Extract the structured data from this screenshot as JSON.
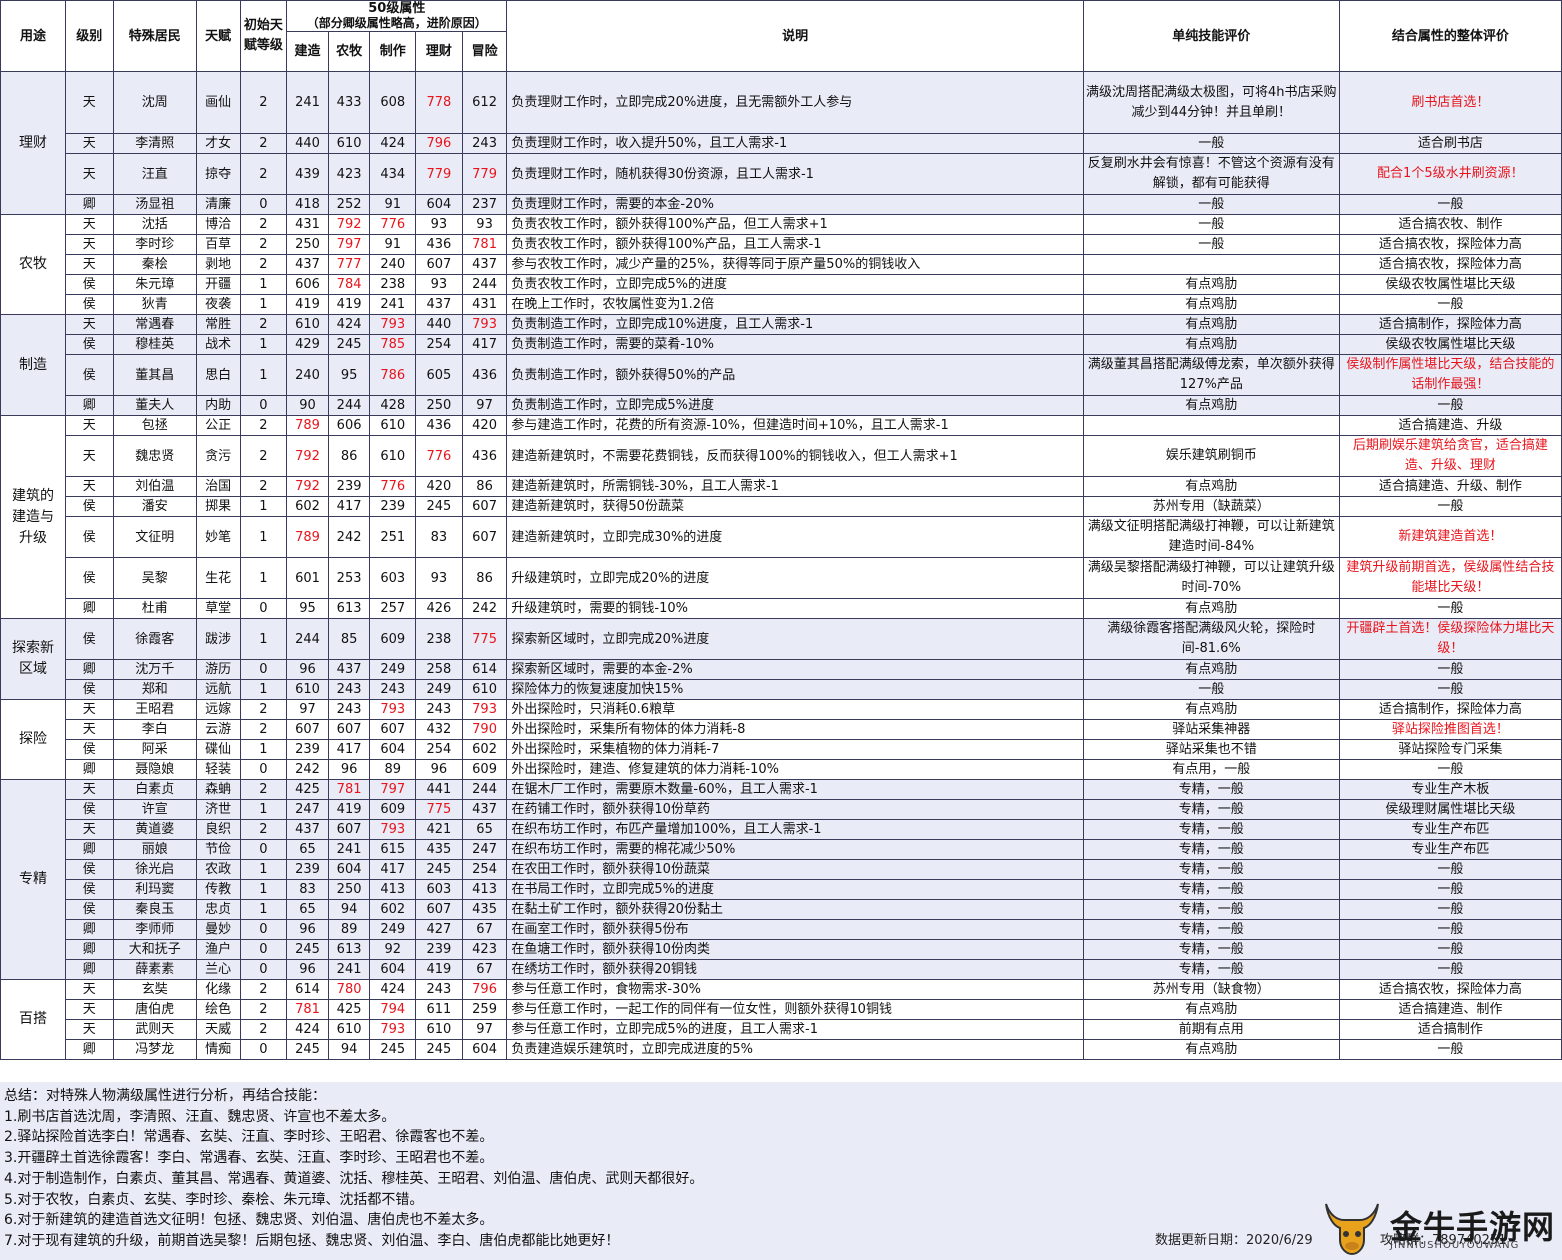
{
  "headers": {
    "use": "用途",
    "rank": "级别",
    "resident": "特殊居民",
    "talent": "天赋",
    "init_level": "初始天赋等级",
    "attr_group": "50级属性",
    "attr_note": "（部分卿级属性略高，进阶原因）",
    "build": "建造",
    "farm": "农牧",
    "craft": "制作",
    "finance": "理财",
    "explore": "冒险",
    "desc": "说明",
    "skill_eval": "单纯技能评价",
    "overall_eval": "结合属性的整体评价"
  },
  "groups": [
    {
      "label": "理财",
      "rows": [
        {
          "rank": "天",
          "name": "沈周",
          "talent": "画仙",
          "lvl": "2",
          "v": [
            "241",
            "433",
            "608",
            "778",
            "612"
          ],
          "red": [
            3
          ],
          "desc": "负责理财工作时，立即完成20%进度，且无需额外工人参与",
          "eval": "满级沈周搭配满级太极图，可将4h书店采购减少到44分钟！并且单刷！",
          "eval_red": false,
          "overall": "刷书店首选！",
          "overall_red": true,
          "tall": 3
        },
        {
          "rank": "天",
          "name": "李清照",
          "talent": "才女",
          "lvl": "2",
          "v": [
            "440",
            "610",
            "424",
            "796",
            "243"
          ],
          "red": [
            3
          ],
          "desc": "负责理财工作时，收入提升50%，且工人需求-1",
          "eval": "一般",
          "overall": "适合刷书店"
        },
        {
          "rank": "天",
          "name": "汪直",
          "talent": "掠夺",
          "lvl": "2",
          "v": [
            "439",
            "423",
            "434",
            "779",
            "779"
          ],
          "red": [
            3,
            4
          ],
          "desc": "负责理财工作时，随机获得30份资源，且工人需求-1",
          "eval": "反复刷水井会有惊喜！不管这个资源有没有解锁，都有可能获得",
          "overall": "配合1个5级水井刷资源！",
          "overall_red": true,
          "tall": 2
        },
        {
          "rank": "卿",
          "name": "汤显祖",
          "talent": "清廉",
          "lvl": "0",
          "v": [
            "418",
            "252",
            "91",
            "604",
            "237"
          ],
          "red": [],
          "desc": "负责理财工作时，需要的本金-20%",
          "eval": "一般",
          "overall": "一般"
        }
      ]
    },
    {
      "label": "农牧",
      "rows": [
        {
          "rank": "天",
          "name": "沈括",
          "talent": "博洽",
          "lvl": "2",
          "v": [
            "431",
            "792",
            "776",
            "93",
            "93"
          ],
          "red": [
            1,
            2
          ],
          "desc": "负责农牧工作时，额外获得100%产品，但工人需求+1",
          "eval": "一般",
          "overall": "适合搞农牧、制作"
        },
        {
          "rank": "天",
          "name": "李时珍",
          "talent": "百草",
          "lvl": "2",
          "v": [
            "250",
            "797",
            "91",
            "436",
            "781"
          ],
          "red": [
            1,
            4
          ],
          "desc": "负责农牧工作时，额外获得100%产品，且工人需求-1",
          "eval": "一般",
          "overall": "适合搞农牧，探险体力高"
        },
        {
          "rank": "天",
          "name": "秦桧",
          "talent": "剥地",
          "lvl": "2",
          "v": [
            "437",
            "777",
            "240",
            "607",
            "437"
          ],
          "red": [
            1
          ],
          "desc": "参与农牧工作时，减少产量的25%，获得等同于原产量50%的铜钱收入",
          "eval": "",
          "overall": "适合搞农牧，探险体力高"
        },
        {
          "rank": "侯",
          "name": "朱元璋",
          "talent": "开疆",
          "lvl": "1",
          "v": [
            "606",
            "784",
            "238",
            "93",
            "244"
          ],
          "red": [
            1
          ],
          "desc": "负责农牧工作时，立即完成5%的进度",
          "eval": "有点鸡肋",
          "overall": "侯级农牧属性堪比天级"
        },
        {
          "rank": "侯",
          "name": "狄青",
          "talent": "夜袭",
          "lvl": "1",
          "v": [
            "419",
            "419",
            "241",
            "437",
            "431"
          ],
          "red": [],
          "desc": "在晚上工作时，农牧属性变为1.2倍",
          "eval": "有点鸡肋",
          "overall": "一般"
        }
      ]
    },
    {
      "label": "制造",
      "rows": [
        {
          "rank": "天",
          "name": "常遇春",
          "talent": "常胜",
          "lvl": "2",
          "v": [
            "610",
            "424",
            "793",
            "440",
            "793"
          ],
          "red": [
            2,
            4
          ],
          "desc": "负责制造工作时，立即完成10%进度，且工人需求-1",
          "eval": "有点鸡肋",
          "overall": "适合搞制作，探险体力高"
        },
        {
          "rank": "侯",
          "name": "穆桂英",
          "talent": "战术",
          "lvl": "1",
          "v": [
            "429",
            "245",
            "785",
            "254",
            "417"
          ],
          "red": [
            2
          ],
          "desc": "负责制造工作时，需要的菜肴-10%",
          "eval": "有点鸡肋",
          "overall": "侯级农牧属性堪比天级"
        },
        {
          "rank": "侯",
          "name": "董其昌",
          "talent": "思白",
          "lvl": "1",
          "v": [
            "240",
            "95",
            "786",
            "605",
            "436"
          ],
          "red": [
            2
          ],
          "desc": "负责制造工作时，额外获得50%的产品",
          "eval": "满级董其昌搭配满级傅龙索，单次额外获得127%产品",
          "overall": "侯级制作属性堪比天级，结合技能的话制作最强！",
          "overall_red": true,
          "tall": 2
        },
        {
          "rank": "卿",
          "name": "董夫人",
          "talent": "内助",
          "lvl": "0",
          "v": [
            "90",
            "244",
            "428",
            "250",
            "97"
          ],
          "red": [],
          "desc": "负责制造工作时，立即完成5%进度",
          "eval": "有点鸡肋",
          "overall": "一般"
        }
      ]
    },
    {
      "label": "建筑的建造与升级",
      "rows": [
        {
          "rank": "天",
          "name": "包拯",
          "talent": "公正",
          "lvl": "2",
          "v": [
            "789",
            "606",
            "610",
            "436",
            "420"
          ],
          "red": [
            0
          ],
          "desc": "参与建造工作时，花费的所有资源-10%，但建造时间+10%，且工人需求-1",
          "eval": "",
          "overall": "适合搞建造、升级"
        },
        {
          "rank": "天",
          "name": "魏忠贤",
          "talent": "贪污",
          "lvl": "2",
          "v": [
            "792",
            "86",
            "610",
            "776",
            "436"
          ],
          "red": [
            0,
            3
          ],
          "desc": "建造新建筑时，不需要花费铜钱，反而获得100%的铜钱收入，但工人需求+1",
          "eval": "娱乐建筑刷铜币",
          "overall": "后期刷娱乐建筑给贪官，适合搞建造、升级、理财",
          "overall_red": true,
          "tall": 2
        },
        {
          "rank": "天",
          "name": "刘伯温",
          "talent": "治国",
          "lvl": "2",
          "v": [
            "792",
            "239",
            "776",
            "420",
            "86"
          ],
          "red": [
            0,
            2
          ],
          "desc": "建造新建筑时，所需铜钱-30%，且工人需求-1",
          "eval": "有点鸡肋",
          "overall": "适合搞建造、升级、制作"
        },
        {
          "rank": "侯",
          "name": "潘安",
          "talent": "掷果",
          "lvl": "1",
          "v": [
            "602",
            "417",
            "239",
            "245",
            "607"
          ],
          "red": [],
          "desc": "建造新建筑时，获得50份蔬菜",
          "eval": "苏州专用（缺蔬菜）",
          "overall": "一般"
        },
        {
          "rank": "侯",
          "name": "文征明",
          "talent": "妙笔",
          "lvl": "1",
          "v": [
            "789",
            "242",
            "251",
            "83",
            "607"
          ],
          "red": [
            0
          ],
          "desc": "建造新建筑时，立即完成30%的进度",
          "eval": "满级文征明搭配满级打神鞭，可以让新建筑建造时间-84%",
          "overall": "新建筑建造首选！",
          "overall_red": true,
          "tall": 2
        },
        {
          "rank": "侯",
          "name": "吴黎",
          "talent": "生花",
          "lvl": "1",
          "v": [
            "601",
            "253",
            "603",
            "93",
            "86"
          ],
          "red": [],
          "desc": "升级建筑时，立即完成20%的进度",
          "eval": "满级吴黎搭配满级打神鞭，可以让建筑升级时间-70%",
          "overall": "建筑升级前期首选，侯级属性结合技能堪比天级！",
          "overall_red": true,
          "tall": 2
        },
        {
          "rank": "卿",
          "name": "杜甫",
          "talent": "草堂",
          "lvl": "0",
          "v": [
            "95",
            "613",
            "257",
            "426",
            "242"
          ],
          "red": [],
          "desc": "升级建筑时，需要的铜钱-10%",
          "eval": "有点鸡肋",
          "overall": "一般"
        }
      ]
    },
    {
      "label": "探索新区域",
      "rows": [
        {
          "rank": "侯",
          "name": "徐霞客",
          "talent": "跋涉",
          "lvl": "1",
          "v": [
            "244",
            "85",
            "609",
            "238",
            "775"
          ],
          "red": [
            4
          ],
          "desc": "探索新区域时，立即完成20%进度",
          "eval": "满级徐霞客搭配满级风火轮，探险时间-81.6%",
          "overall": "开疆辟土首选！侯级探险体力堪比天级！",
          "overall_red": true,
          "tall": 2
        },
        {
          "rank": "卿",
          "name": "沈万千",
          "talent": "游历",
          "lvl": "0",
          "v": [
            "96",
            "437",
            "249",
            "258",
            "614"
          ],
          "red": [],
          "desc": "探索新区域时，需要的本金-2%",
          "eval": "有点鸡肋",
          "overall": "一般"
        },
        {
          "rank": "侯",
          "name": "郑和",
          "talent": "远航",
          "lvl": "1",
          "v": [
            "610",
            "243",
            "243",
            "249",
            "610"
          ],
          "red": [],
          "desc": "探险体力的恢复速度加快15%",
          "eval": "一般",
          "overall": "一般"
        }
      ]
    },
    {
      "label": "探险",
      "rows": [
        {
          "rank": "天",
          "name": "王昭君",
          "talent": "远嫁",
          "lvl": "2",
          "v": [
            "97",
            "243",
            "793",
            "243",
            "793"
          ],
          "red": [
            2,
            4
          ],
          "desc": "外出探险时，只消耗0.6粮草",
          "eval": "有点鸡肋",
          "overall": "适合搞制作，探险体力高"
        },
        {
          "rank": "天",
          "name": "李白",
          "talent": "云游",
          "lvl": "2",
          "v": [
            "607",
            "607",
            "607",
            "432",
            "790"
          ],
          "red": [
            4
          ],
          "desc": "外出探险时，采集所有物体的体力消耗-8",
          "eval": "驿站采集神器",
          "overall": "驿站探险推图首选！",
          "overall_red": true
        },
        {
          "rank": "侯",
          "name": "阿采",
          "talent": "碟仙",
          "lvl": "1",
          "v": [
            "239",
            "417",
            "604",
            "254",
            "602"
          ],
          "red": [],
          "desc": "外出探险时，采集植物的体力消耗-7",
          "eval": "驿站采集也不错",
          "overall": "驿站探险专门采集"
        },
        {
          "rank": "卿",
          "name": "聂隐娘",
          "talent": "轻装",
          "lvl": "0",
          "v": [
            "242",
            "96",
            "89",
            "96",
            "609"
          ],
          "red": [],
          "desc": "外出探险时，建造、修复建筑的体力消耗-10%",
          "eval": "有点用，一般",
          "overall": "一般"
        }
      ]
    },
    {
      "label": "专精",
      "rows": [
        {
          "rank": "天",
          "name": "白素贞",
          "talent": "森蚺",
          "lvl": "2",
          "v": [
            "425",
            "781",
            "797",
            "441",
            "244"
          ],
          "red": [
            1,
            2
          ],
          "desc": "在锯木厂工作时，需要原木数量-60%，且工人需求-1",
          "eval": "专精，一般",
          "overall": "专业生产木板"
        },
        {
          "rank": "侯",
          "name": "许宣",
          "talent": "济世",
          "lvl": "1",
          "v": [
            "247",
            "419",
            "609",
            "775",
            "437"
          ],
          "red": [
            3
          ],
          "desc": "在药铺工作时，额外获得10份草药",
          "eval": "专精，一般",
          "overall": "侯级理财属性堪比天级"
        },
        {
          "rank": "天",
          "name": "黄道婆",
          "talent": "良织",
          "lvl": "2",
          "v": [
            "437",
            "607",
            "793",
            "421",
            "65"
          ],
          "red": [
            2
          ],
          "desc": "在织布坊工作时，布匹产量增加100%，且工人需求-1",
          "eval": "专精，一般",
          "overall": "专业生产布匹"
        },
        {
          "rank": "卿",
          "name": "丽娘",
          "talent": "节俭",
          "lvl": "0",
          "v": [
            "65",
            "241",
            "615",
            "435",
            "247"
          ],
          "red": [],
          "desc": "在织布坊工作时，需要的棉花减少50%",
          "eval": "专精，一般",
          "overall": "专业生产布匹"
        },
        {
          "rank": "侯",
          "name": "徐光启",
          "talent": "农政",
          "lvl": "1",
          "v": [
            "239",
            "604",
            "417",
            "245",
            "254"
          ],
          "red": [],
          "desc": "在农田工作时，额外获得10份蔬菜",
          "eval": "专精，一般",
          "overall": "一般"
        },
        {
          "rank": "侯",
          "name": "利玛窦",
          "talent": "传教",
          "lvl": "1",
          "v": [
            "83",
            "250",
            "413",
            "603",
            "413"
          ],
          "red": [],
          "desc": "在书局工作时，立即完成5%的进度",
          "eval": "专精，一般",
          "overall": "一般"
        },
        {
          "rank": "侯",
          "name": "秦良玉",
          "talent": "忠贞",
          "lvl": "1",
          "v": [
            "65",
            "94",
            "602",
            "607",
            "435"
          ],
          "red": [],
          "desc": "在黏土矿工作时，额外获得20份黏土",
          "eval": "专精，一般",
          "overall": "一般"
        },
        {
          "rank": "卿",
          "name": "李师师",
          "talent": "曼妙",
          "lvl": "0",
          "v": [
            "96",
            "89",
            "249",
            "427",
            "67"
          ],
          "red": [],
          "desc": "在画室工作时，额外获得5份布",
          "eval": "专精，一般",
          "overall": "一般"
        },
        {
          "rank": "卿",
          "name": "大和抚子",
          "talent": "渔户",
          "lvl": "0",
          "v": [
            "245",
            "613",
            "92",
            "239",
            "423"
          ],
          "red": [],
          "desc": "在鱼塘工作时，额外获得10份肉类",
          "eval": "专精，一般",
          "overall": "一般"
        },
        {
          "rank": "卿",
          "name": "薛素素",
          "talent": "兰心",
          "lvl": "0",
          "v": [
            "96",
            "241",
            "604",
            "419",
            "67"
          ],
          "red": [],
          "desc": "在绣坊工作时，额外获得20铜钱",
          "eval": "专精，一般",
          "overall": "一般"
        }
      ]
    },
    {
      "label": "百搭",
      "rows": [
        {
          "rank": "天",
          "name": "玄奘",
          "talent": "化缘",
          "lvl": "2",
          "v": [
            "614",
            "780",
            "424",
            "243",
            "796"
          ],
          "red": [
            1,
            4
          ],
          "desc": "参与任意工作时，食物需求-30%",
          "eval": "苏州专用（缺食物）",
          "overall": "适合搞农牧，探险体力高"
        },
        {
          "rank": "天",
          "name": "唐伯虎",
          "talent": "绘色",
          "lvl": "2",
          "v": [
            "781",
            "425",
            "794",
            "611",
            "259"
          ],
          "red": [
            0,
            2
          ],
          "desc": "参与任意工作时，一起工作的同伴有一位女性，则额外获得10铜钱",
          "eval": "有点鸡肋",
          "overall": "适合搞建造、制作"
        },
        {
          "rank": "天",
          "name": "武则天",
          "talent": "天威",
          "lvl": "2",
          "v": [
            "424",
            "610",
            "793",
            "610",
            "97"
          ],
          "red": [
            2
          ],
          "desc": "参与任意工作时，立即完成5%的进度，且工人需求-1",
          "eval": "前期有点用",
          "overall": "适合搞制作"
        },
        {
          "rank": "卿",
          "name": "冯梦龙",
          "talent": "情痴",
          "lvl": "0",
          "v": [
            "245",
            "94",
            "245",
            "245",
            "604"
          ],
          "red": [],
          "desc": "负责建造娱乐建筑时，立即完成进度的5%",
          "eval": "有点鸡肋",
          "overall": "一般"
        }
      ]
    }
  ],
  "summary": [
    "总结：对特殊人物满级属性进行分析，再结合技能：",
    "1.刷书店首选沈周，李清照、汪直、魏忠贤、许宣也不差太多。",
    "2.驿站探险首选李白！常遇春、玄奘、汪直、李时珍、王昭君、徐霞客也不差。",
    "3.开疆辟土首选徐霞客！李白、常遇春、玄奘、汪直、李时珍、王昭君也不差。",
    "4.对于制造制作，白素贞、董其昌、常遇春、黄道婆、沈括、穆桂英、王昭君、刘伯温、唐伯虎、武则天都很好。",
    "5.对于农牧，白素贞、玄奘、李时珍、秦桧、朱元璋、沈括都不错。",
    "6.对于新建筑的建造首选文征明！包拯、魏忠贤、刘伯温、唐伯虎也不差太多。",
    "7.对于现有建筑的升级，前期首选吴黎！后期包拯、魏忠贤、刘伯温、李白、唐伯虎都能比她更好！"
  ],
  "footer": {
    "update": "数据更新日期：2020/6/29",
    "qq": "攻略群：789740251",
    "logo_title": "金牛手游网",
    "logo_sub": "JINNIUSHOUYOUWANG"
  },
  "colors": {
    "highlight": "#e8141c",
    "band": "#e9ecf7",
    "border": "#3a3a5a"
  }
}
